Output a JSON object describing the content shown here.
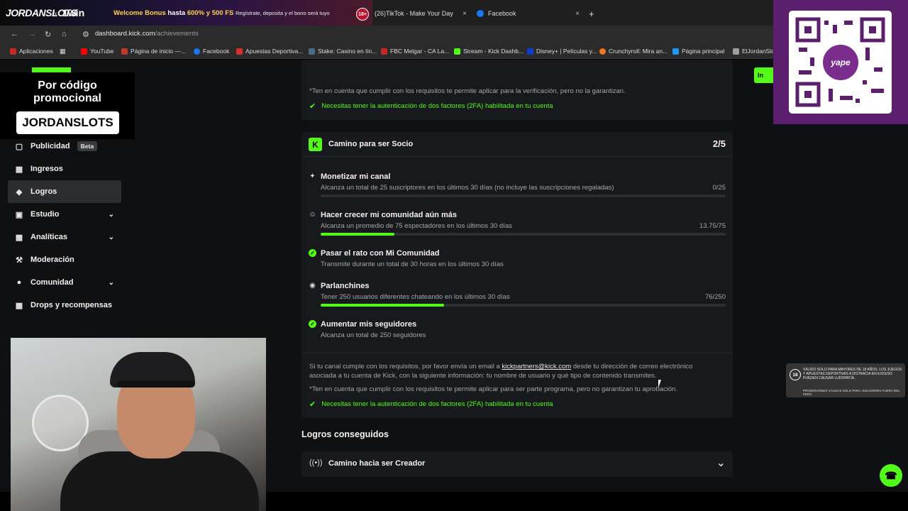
{
  "promo": {
    "brand": "JORDANSLOTS",
    "x": "x",
    "partner": "1win",
    "bonus_a": "Welcome Bonus ",
    "bonus_b": "hasta ",
    "bonus_c": "600% y 500 FS",
    "sub": "Regístrate, deposita y el bono será tuyo",
    "age": "18+"
  },
  "tabs": [
    {
      "title": "(26)TikTok - Make Your Day",
      "close": "×"
    },
    {
      "title": "Facebook",
      "close": "×"
    }
  ],
  "new_tab": "+",
  "address": {
    "host": "dashboard.kick.com",
    "path": "/achievements"
  },
  "bookmarks": [
    {
      "label": "Aplicaciones",
      "color": "#e0e0e0"
    },
    {
      "label": "YouTube",
      "color": "#ff0000"
    },
    {
      "label": "Página de inicio —...",
      "color": "#c0392b"
    },
    {
      "label": "Facebook",
      "color": "#1877f2"
    },
    {
      "label": "Apuestas Deportiva...",
      "color": "#d32f2f"
    },
    {
      "label": "Stake: Casino en lín...",
      "color": "#1a2c38"
    },
    {
      "label": "FBC Melgar - CA La...",
      "color": "#c62828"
    },
    {
      "label": "Stream - Kick Dashb...",
      "color": "#53fc18"
    },
    {
      "label": "Disney+ | Películas y...",
      "color": "#113ccf"
    },
    {
      "label": "Crunchyroll: Mira an...",
      "color": "#f47521"
    },
    {
      "label": "Página principal",
      "color": "#2196f3"
    },
    {
      "label": "ElJordanSlots",
      "color": "#9e9e9e"
    }
  ],
  "promo_code": {
    "line1": "Por código",
    "line2": "promocional",
    "code": "JORDANSLOTS"
  },
  "sidebar": {
    "items": [
      {
        "label": "Publicidad",
        "badge": "Beta",
        "icon": "megaphone-icon"
      },
      {
        "label": "Ingresos",
        "icon": "chart-icon"
      },
      {
        "label": "Logros",
        "icon": "trophy-icon",
        "active": true
      },
      {
        "label": "Estudio",
        "icon": "studio-icon",
        "chevron": true
      },
      {
        "label": "Analíticas",
        "icon": "analytics-icon",
        "chevron": true
      },
      {
        "label": "Moderación",
        "icon": "wrench-icon"
      },
      {
        "label": "Comunidad",
        "icon": "community-icon",
        "chevron": true
      },
      {
        "label": "Drops y recompensas",
        "icon": "gift-icon"
      }
    ]
  },
  "top_card": {
    "note": "*Ten en cuenta que cumplir con los requisitos te permite aplicar para la verificación, pero no la garantizan.",
    "check": "Necesitas tener la autenticación de dos factores (2FA) habilitada en tu cuenta"
  },
  "partner_card": {
    "title": "Camino para ser Socio",
    "progress": "2/5",
    "requirements": [
      {
        "title": "Monetizar mi canal",
        "desc": "Alcanza un total de 25 suscriptores en los últimos 30 días (no incluye las suscripciones regaladas)",
        "value": "0/25",
        "fraction": 0.0,
        "done": false
      },
      {
        "title": "Hacer crecer mi comunidad aún más",
        "desc": "Alcanza un promedio de 75 espectadores en los últimos 30 días",
        "value": "13.75/75",
        "fraction": 0.183,
        "done": false
      },
      {
        "title": "Pasar el rato con Mi Comunidad",
        "desc": "Transmite durante un total de 30 horas en los últimos 30 días",
        "done": true
      },
      {
        "title": "Parlanchines",
        "desc": "Tener 250 usuarios diferentes chateando en los últimos 30 días",
        "value": "76/250",
        "fraction": 0.304,
        "done": false
      },
      {
        "title": "Aumentar mis seguidores",
        "desc": "Alcanza un total de 250 seguidores",
        "done": true
      }
    ],
    "footer_a": "Si tu canal cumple con los requisitos, por favor envía un email a ",
    "footer_link": "kickpartners@kick.com",
    "footer_b": " desde tu dirección de correo electrónico",
    "footer_c": "asociada a tu cuenta de Kick, con la siguiente información: tu nombre de usuario y qué tipo de contenido transmites.",
    "note": "*Ten en cuenta que cumplir con los requisitos te permite aplicar para ser parte programa, pero no garantizan tu aprobación.",
    "check": "Necesitas tener la autenticación de dos factores (2FA) habilitada en tu cuenta"
  },
  "achieved": {
    "title": "Logros conseguidos",
    "item": "Camino hacia ser Creador"
  },
  "qr": {
    "logo": "yape"
  },
  "legal": {
    "age": "18",
    "text": "Válido solo para mayores de 18 años. Los juegos y apuestas deportivas a distancia en exceso pueden causar ludopatía.",
    "text2": "Promociones válidas solo para jugadores fuera del Perú"
  },
  "green_tab": "In",
  "colors": {
    "accent": "#53fc18",
    "card": "#18191c",
    "bg": "#0f1012"
  }
}
